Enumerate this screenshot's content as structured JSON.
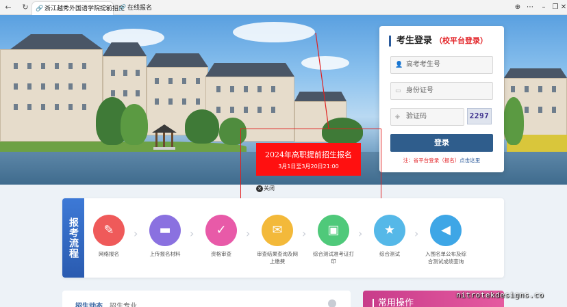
{
  "browser": {
    "active_tab": "浙江越秀外国语学院提前招生",
    "second_tab": "在线报名",
    "icons": [
      "back-icon",
      "forward-icon",
      "refresh-icon",
      "globe-icon",
      "more-icon",
      "minimize-icon",
      "restore-icon",
      "close-icon"
    ]
  },
  "login": {
    "title": "考生登录",
    "subtitle": "（校平台登录）",
    "fields": {
      "exam_no": "高考考生号",
      "id_no": "身份证号",
      "captcha": "验证码"
    },
    "captcha_value": "2297",
    "submit": "登录",
    "note_prefix": "注：省平台登录（报名）",
    "note_link": "点击这里"
  },
  "popup": {
    "title": "2024年高职提前招生报名",
    "date": "3月1日至3月20日21:00",
    "close": "关闭"
  },
  "process": {
    "label": "报考流程",
    "steps": [
      {
        "label": "网络报名",
        "color": "#ef5a5a",
        "icon": "user-edit-icon"
      },
      {
        "label": "上传报名材料",
        "color": "#8a71e0",
        "icon": "card-icon"
      },
      {
        "label": "资格审查",
        "color": "#e85aa8",
        "icon": "check-icon"
      },
      {
        "label": "审查结果查询及网上缴费",
        "color": "#f3b93a",
        "icon": "ticket-icon"
      },
      {
        "label": "综合测试准考证打印",
        "color": "#4fc97a",
        "icon": "id-card-icon"
      },
      {
        "label": "综合测试",
        "color": "#55b8e8",
        "icon": "medal-icon"
      },
      {
        "label": "入围名单公布及综合测试成绩查询",
        "color": "#3ea6e6",
        "icon": "megaphone-icon"
      }
    ]
  },
  "news": {
    "tab1": "招生动态",
    "tab2": "招生专业"
  },
  "ops": {
    "title": "常用操作"
  },
  "watermark": "nitrotekdesigns.co"
}
